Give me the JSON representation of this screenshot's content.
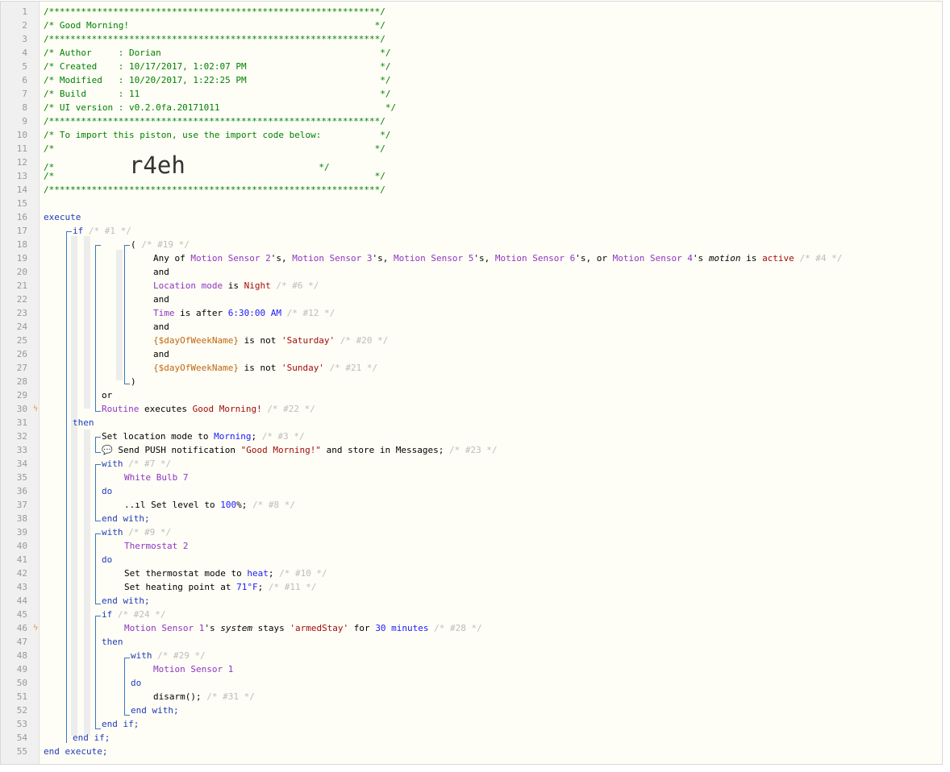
{
  "gutter": {
    "line_numbers": [
      "1",
      "2",
      "3",
      "4",
      "5",
      "6",
      "7",
      "8",
      "9",
      "10",
      "11",
      "12",
      "13",
      "14",
      "15",
      "16",
      "17",
      "18",
      "19",
      "20",
      "21",
      "22",
      "23",
      "24",
      "25",
      "26",
      "27",
      "28",
      "29",
      "30",
      "31",
      "32",
      "33",
      "34",
      "35",
      "36",
      "37",
      "38",
      "39",
      "40",
      "41",
      "42",
      "43",
      "44",
      "45",
      "46",
      "47",
      "48",
      "49",
      "50",
      "51",
      "52",
      "53",
      "54",
      "55"
    ]
  },
  "header": {
    "border": "/**************************************************************/",
    "title_line": "/* Good Morning!                                              */",
    "author_line": "/* Author     : Dorian                                         */",
    "created_line": "/* Created    : 10/17/2017, 1:02:07 PM                         */",
    "modified_line": "/* Modified   : 10/20/2017, 1:22:25 PM                         */",
    "build_line": "/* Build      : 11                                             */",
    "ui_line": "/* UI version : v0.2.0fa.20171011                               */",
    "import_line": "/* To import this piston, use the import code below:           */",
    "blank_line": "/*                                                            */",
    "code_prefix": "/*              ",
    "import_code": "r4eh",
    "code_suffix": "                         */"
  },
  "code": {
    "execute": "execute",
    "end_execute": "end execute;",
    "if": "if",
    "then": "then",
    "and": "and",
    "or": "or",
    "end_if": "end if;",
    "with": "with",
    "do": "do",
    "end_with": "end with;",
    "c1": "/* #1 */",
    "c19": "/* #19 */",
    "paren_open": "(",
    "paren_close": ")",
    "any_of": "Any of ",
    "ms2": "Motion Sensor 2",
    "ms3": "Motion Sensor 3",
    "ms5": "Motion Sensor 5",
    "ms6": "Motion Sensor 6",
    "ms4": "Motion Sensor 4",
    "ms1": "Motion Sensor 1",
    "poss_sep": "'s, ",
    "poss_or": "'s, or ",
    "poss": "'s ",
    "motion": "motion",
    "is": " is ",
    "active": "active",
    "c4": "/* #4 */",
    "location_mode": "Location mode",
    "night": "Night",
    "c6": "/* #6 */",
    "time": "Time",
    "is_after": " is after ",
    "time_val": "6:30:00 AM",
    "c12": "/* #12 */",
    "dow": "{$dayOfWeekName}",
    "is_not": " is not ",
    "saturday": "'Saturday'",
    "c20": "/* #20 */",
    "sunday": "'Sunday'",
    "c21": "/* #21 */",
    "routine": "Routine",
    "executes": " executes ",
    "good_morning": "Good Morning!",
    "c22": "/* #22 */",
    "set_loc_mode": "Set location mode to ",
    "morning": "Morning",
    "semicolon": ";",
    "c3": "/* #3 */",
    "chat_icon": "💬",
    "send_push": " Send PUSH notification ",
    "push_msg": "\"Good Morning!\"",
    "store_in": " and store in Messages;",
    "c23": "/* #23 */",
    "c7": "/* #7 */",
    "white_bulb": "White Bulb 7",
    "level_icon": "..ıl",
    "set_level": " Set level to ",
    "level_val": "100",
    "pct": "%;",
    "c8": "/* #8 */",
    "c9": "/* #9 */",
    "thermostat": "Thermostat 2",
    "set_thermo_mode": "Set thermostat mode to ",
    "heat": "heat",
    "c10": "/* #10 */",
    "set_heating": "Set heating point at ",
    "temp": "71°F",
    "c11": "/* #11 */",
    "c24": "/* #24 */",
    "system": "system",
    "stays": " stays ",
    "armed_stay": "'armedStay'",
    "for_word": " for ",
    "minutes": "30 minutes",
    "c28": "/* #28 */",
    "c29": "/* #29 */",
    "disarm": "disarm();",
    "c31": "/* #31 */"
  },
  "bolt_lines": [
    30,
    46
  ],
  "colors": {
    "comment": "#008000",
    "keyword": "#1f3bb8",
    "device": "#8e35c4",
    "value": "#a30a0a",
    "number": "#1a1aff",
    "bolt": "#e8944a"
  }
}
